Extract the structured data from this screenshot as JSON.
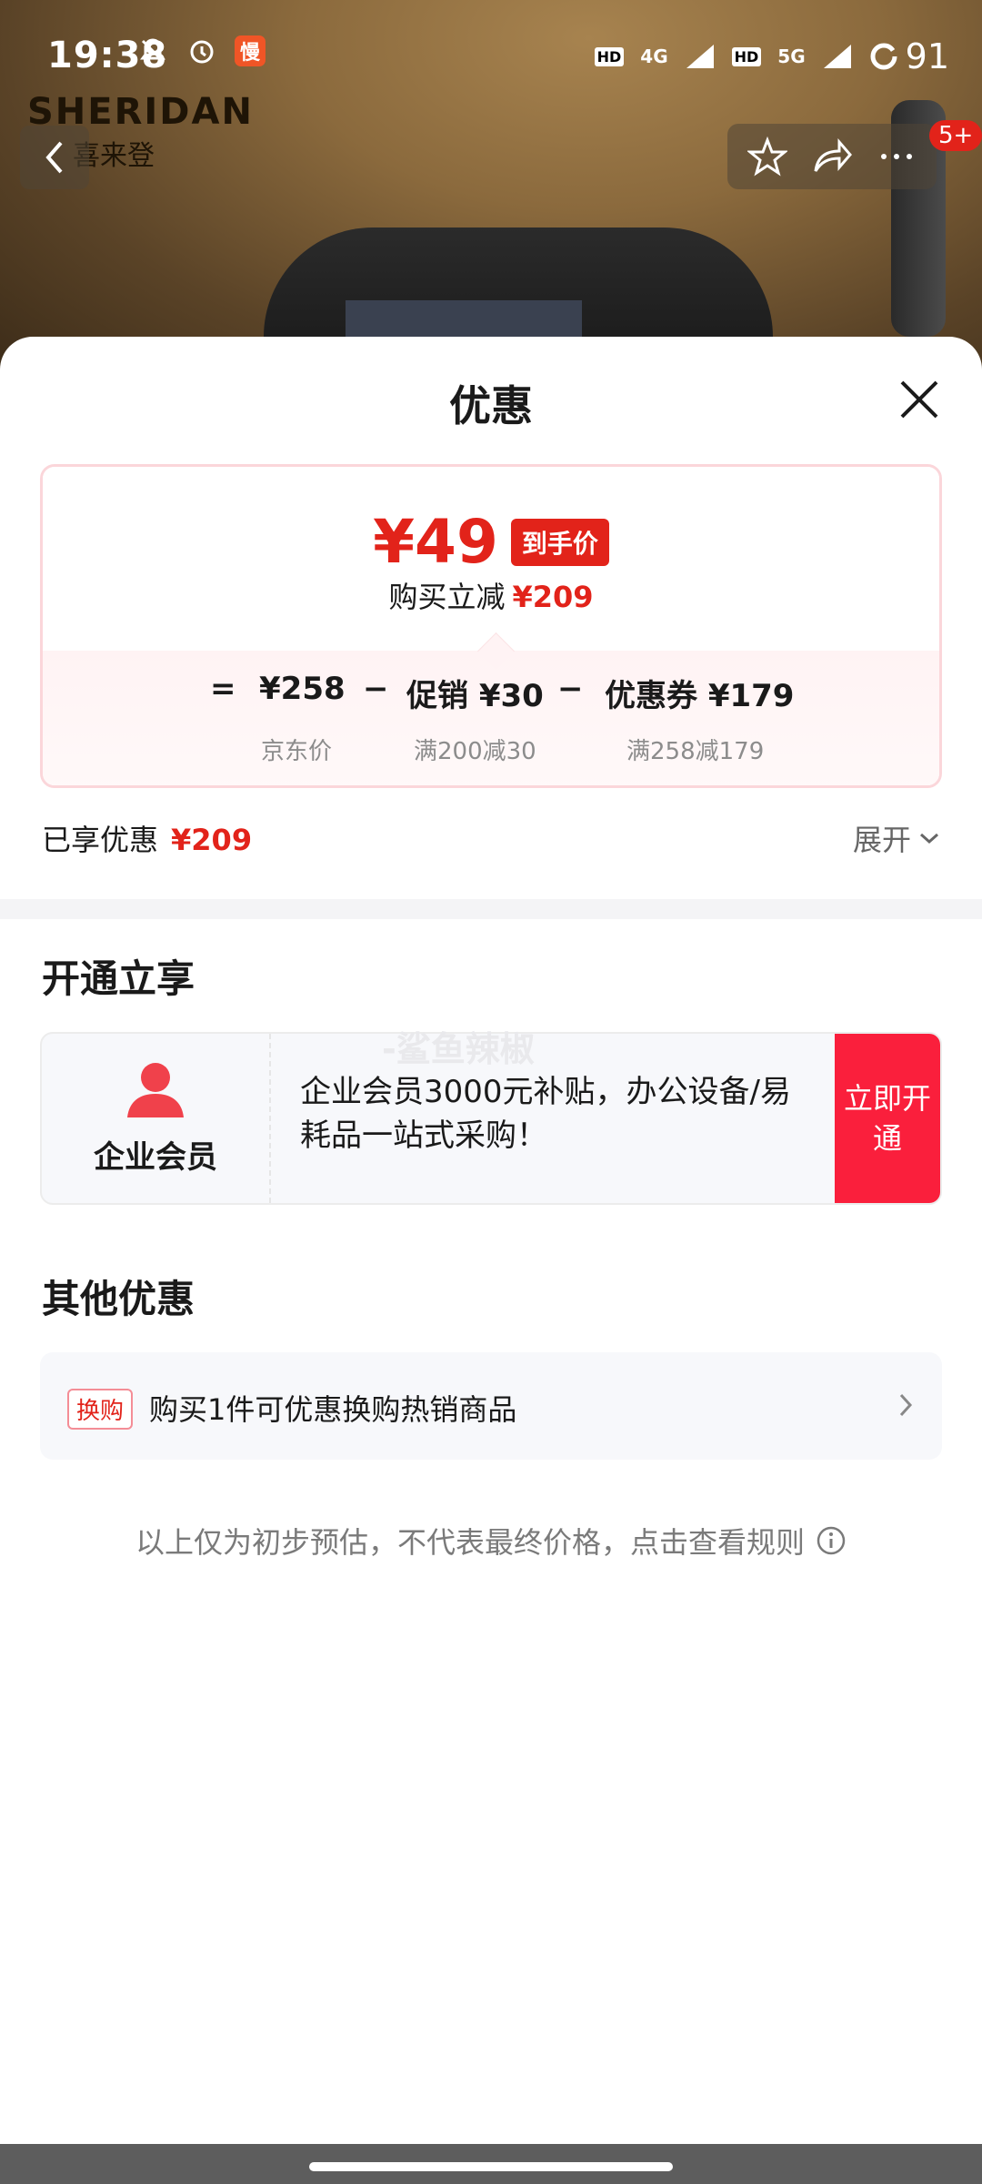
{
  "status_bar": {
    "time": "19:38",
    "notification_app_label": "慢",
    "network_1": "4G",
    "network_2": "5G",
    "hd_label": "HD",
    "battery": "91"
  },
  "brand": {
    "name_en": "SHERIDAN",
    "name_cn": "喜来登"
  },
  "nav": {
    "badge": "5+"
  },
  "sheet": {
    "title": "优惠",
    "price_card": {
      "final_price": "¥49",
      "final_price_tag": "到手价",
      "discount_label": "购买立减",
      "discount_value": "¥209",
      "formula": {
        "equals": "=",
        "minus": "−",
        "jd_price": "¥258",
        "jd_price_label": "京东价",
        "promo": "促销 ¥30",
        "promo_note": "满200减30",
        "coupon": "优惠券 ¥179",
        "coupon_note": "满258减179"
      }
    },
    "enjoyed_label": "已享优惠",
    "enjoyed_value": "¥209",
    "expand_label": "展开",
    "section_open": "开通立享",
    "member": {
      "label": "企业会员",
      "desc": "企业会员3000元补贴，办公设备/易耗品一站式采购！",
      "button": "立即开通"
    },
    "watermark": "-鲨鱼辣椒",
    "section_other": "其他优惠",
    "other_offer": {
      "tag": "换购",
      "text": "购买1件可优惠换购热销商品"
    },
    "footnote": "以上仅为初步预估，不代表最终价格，点击查看规则"
  },
  "colors": {
    "accent_red": "#e2231a",
    "member_button": "#fa1f3c"
  }
}
